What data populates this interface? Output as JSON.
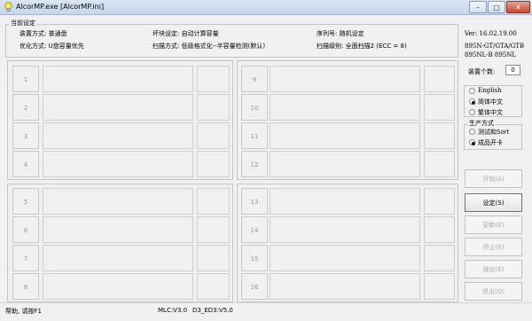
{
  "window": {
    "title": "AlcorMP.exe [AlcorMP.ini]"
  },
  "settings": {
    "title": "当前设定",
    "device_mode": "装置方式: 普通盘",
    "optimize_mode": "优化方式: U盘容量优先",
    "bad_block": "坏块设定: 自动计算容量",
    "scan_mode": "扫描方式: 低级格式化--半容量检测(默认)",
    "serial": "序列号: 随机设定",
    "scan_level": "扫描级别: 全面扫描2 (ECC = 8)"
  },
  "version": {
    "ver": "Ver: 16.02.19.00",
    "line1": "895N-GT/GTA/GTB",
    "line2": "895NL-B 895NL"
  },
  "device_count": {
    "label": "装置个数:",
    "value": "0"
  },
  "language": {
    "options": [
      {
        "label": "English",
        "selected": false
      },
      {
        "label": "简体中文",
        "selected": true
      },
      {
        "label": "繁体中文",
        "selected": false
      }
    ]
  },
  "production": {
    "title": "生产方式",
    "options": [
      {
        "label": "测试和Sort",
        "selected": false
      },
      {
        "label": "成品开卡",
        "selected": true
      }
    ]
  },
  "slots": {
    "top_left": [
      "1",
      "2",
      "3",
      "4"
    ],
    "top_right": [
      "9",
      "10",
      "11",
      "12"
    ],
    "bottom_left": [
      "5",
      "6",
      "7",
      "8"
    ],
    "bottom_right": [
      "13",
      "14",
      "15",
      "16"
    ]
  },
  "buttons": [
    {
      "label": "开始(A)",
      "enabled": false
    },
    {
      "label": "设定(S)",
      "enabled": true
    },
    {
      "label": "更新(E)",
      "enabled": false
    },
    {
      "label": "停止(E)",
      "enabled": false
    },
    {
      "label": "弹出(E)",
      "enabled": false
    },
    {
      "label": "退出(Q)",
      "enabled": false
    }
  ],
  "status": {
    "help": "帮助, 请按F1",
    "mlc": "MLC:V3.0",
    "ed3": "D3_ED3:V5.0"
  }
}
